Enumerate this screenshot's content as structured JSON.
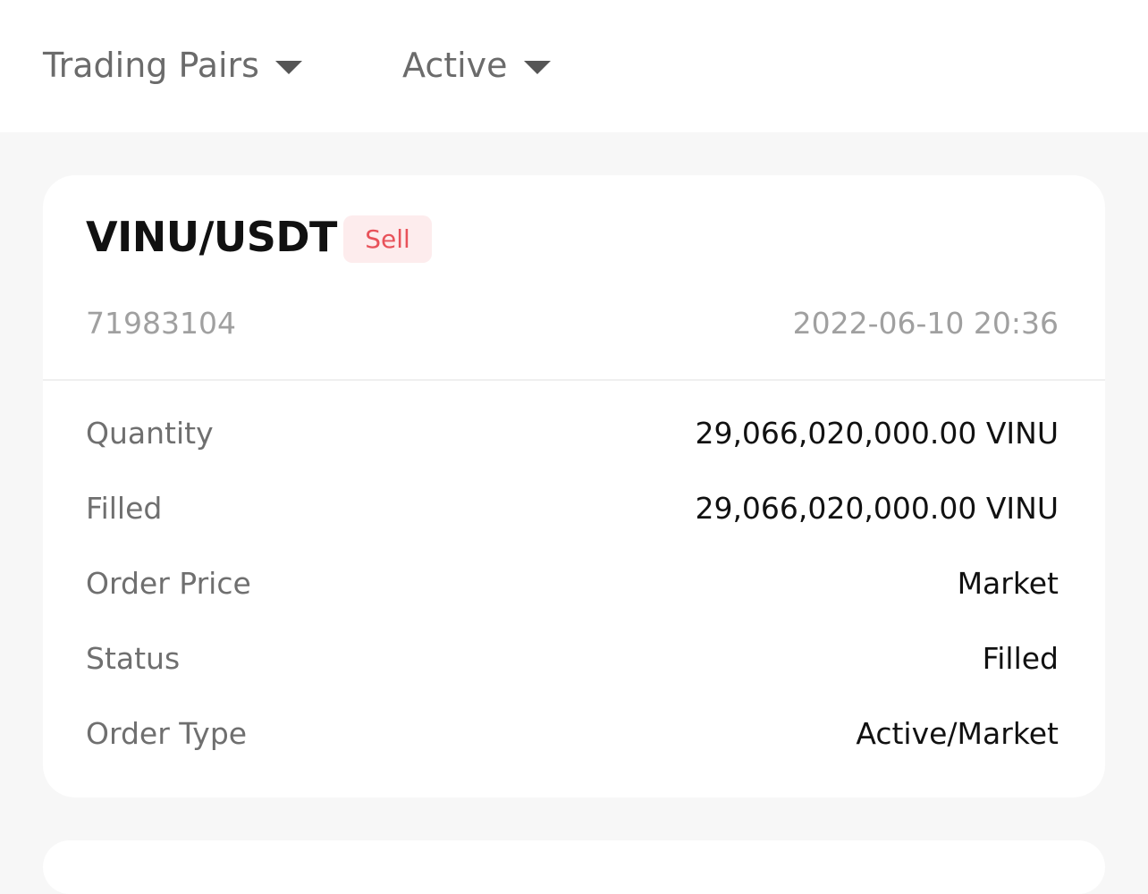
{
  "filters": {
    "trading_pairs": "Trading Pairs",
    "status": "Active"
  },
  "order": {
    "pair": "VINU/USDT",
    "side": "Sell",
    "id": "71983104",
    "time": "2022-06-10 20:36",
    "details": [
      {
        "label": "Quantity",
        "value": "29,066,020,000.00 VINU"
      },
      {
        "label": "Filled",
        "value": "29,066,020,000.00 VINU"
      },
      {
        "label": "Order Price",
        "value": "Market"
      },
      {
        "label": "Status",
        "value": "Filled"
      },
      {
        "label": "Order Type",
        "value": "Active/Market"
      }
    ]
  },
  "colors": {
    "sell_text": "#e8525a",
    "sell_bg": "#fdeced",
    "background": "#f7f7f7"
  },
  "icons": {
    "dropdown": "caret-down-icon"
  }
}
